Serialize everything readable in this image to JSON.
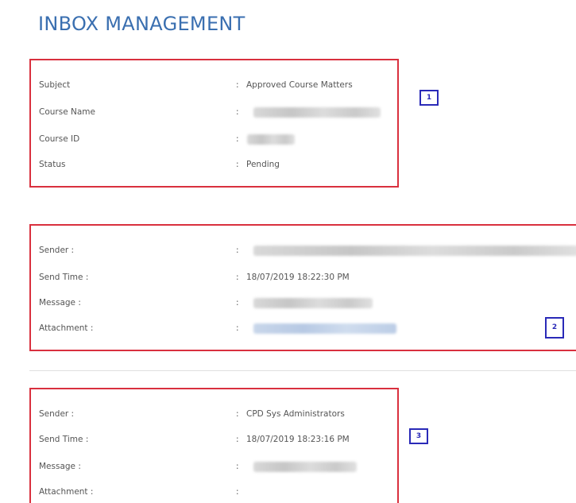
{
  "page": {
    "title": "INBOX MANAGEMENT"
  },
  "details": {
    "subject_label": "Subject",
    "subject_value": "Approved Course Matters",
    "course_name_label": "Course Name",
    "course_id_label": "Course ID",
    "status_label": "Status",
    "status_value": "Pending",
    "badge": "1"
  },
  "messages": [
    {
      "sender_label": "Sender :",
      "send_time_label": "Send Time :",
      "send_time_value": "18/07/2019 18:22:30 PM",
      "message_label": "Message :",
      "attachment_label": "Attachment :",
      "badge": "2"
    },
    {
      "sender_label": "Sender :",
      "sender_value": "CPD Sys Administrators",
      "send_time_label": "Send Time :",
      "send_time_value": "18/07/2019 18:23:16 PM",
      "message_label": "Message :",
      "attachment_label": "Attachment :",
      "badge": "3"
    }
  ],
  "separator": ":",
  "colors": {
    "title": "#3a6fb0",
    "highlight_border": "#d9303e",
    "badge": "#2a2ab8"
  }
}
